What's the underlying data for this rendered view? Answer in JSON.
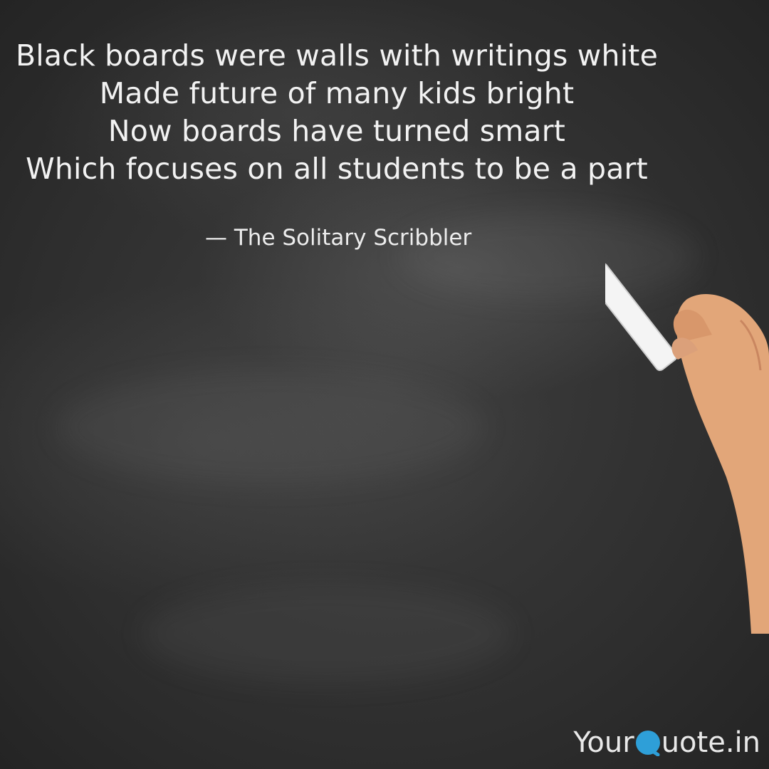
{
  "quote": {
    "lines": [
      "Black boards were walls with writings white",
      "Made future of many kids bright",
      "Now boards have turned smart",
      "Which focuses on all students to be a part"
    ],
    "author": "— The Solitary Scribbler"
  },
  "branding": {
    "prefix": "Your",
    "suffix": "uote.in",
    "icon": "quote-q-icon",
    "accent_color": "#2e9fd8"
  },
  "illustration": {
    "subject": "hand-holding-chalk"
  }
}
